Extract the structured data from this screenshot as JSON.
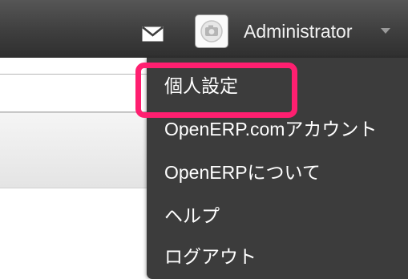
{
  "header": {
    "user_name": "Administrator",
    "icons": {
      "mail": "mail-icon",
      "avatar": "camera-avatar-icon",
      "caret": "caret-down-icon"
    }
  },
  "search": {
    "toggle_icon": "gear-caret-icon"
  },
  "user_menu": {
    "items": [
      {
        "label": "個人設定"
      },
      {
        "label": "OpenERP.comアカウント"
      },
      {
        "label": "OpenERPについて"
      },
      {
        "label": "ヘルプ"
      },
      {
        "label": "ログアウト"
      }
    ]
  },
  "colors": {
    "topbar": "#3e3e3e",
    "dropdown": "#3c3c3c",
    "highlight": "#ff1f70"
  }
}
